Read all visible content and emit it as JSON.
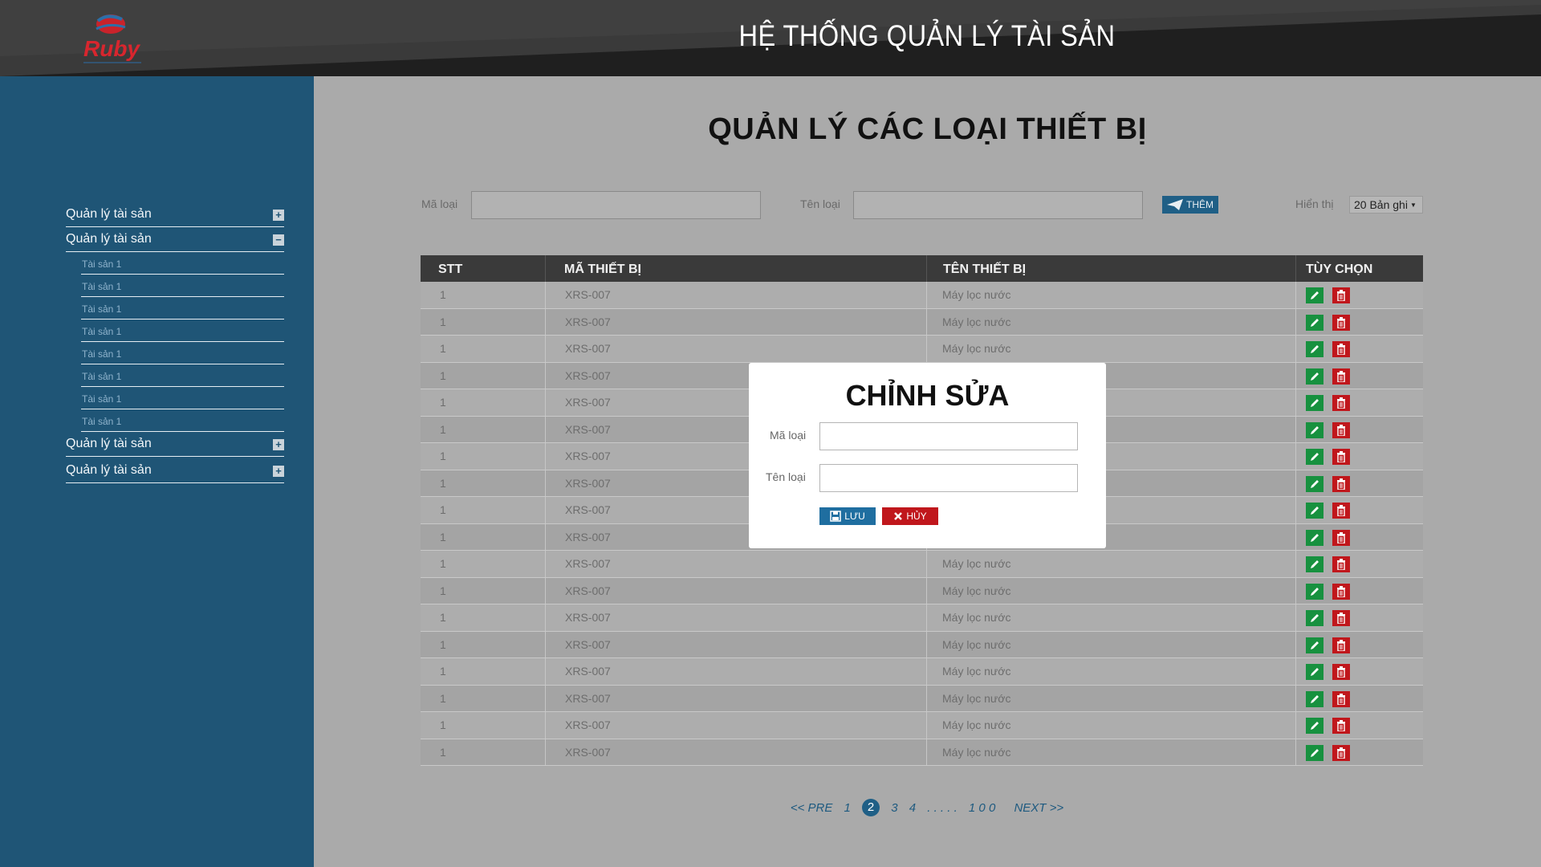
{
  "header": {
    "title": "HỆ THỐNG QUẢN LÝ TÀI SẢN",
    "logo_text": "Ruby"
  },
  "sidebar": {
    "groups": [
      {
        "label": "Quản lý tài sản",
        "toggle": "+"
      },
      {
        "label": "Quản lý tài sản",
        "toggle": "−",
        "items": [
          "Tài sản 1",
          "Tài sản 1",
          "Tài sản 1",
          "Tài sản 1",
          "Tài sản 1",
          "Tài sản 1",
          "Tài sản 1",
          "Tài sản 1"
        ]
      },
      {
        "label": "Quản lý tài sản",
        "toggle": "+"
      },
      {
        "label": "Quản lý tài sản",
        "toggle": "+"
      }
    ]
  },
  "main": {
    "title": "QUẢN LÝ CÁC LOẠI THIẾT BỊ",
    "filter": {
      "code_label": "Mã loại",
      "code_value": "",
      "name_label": "Tên loại",
      "name_value": "",
      "add_label": "THÊM",
      "display_label": "Hiển thị",
      "display_value": "20 Bản ghi"
    },
    "table": {
      "columns": [
        "STT",
        "MÃ THIẾT BỊ",
        "TÊN THIẾT BỊ",
        "TÙY CHỌN"
      ],
      "rows": [
        [
          "1",
          "XRS-007",
          "Máy lọc nước"
        ],
        [
          "1",
          "XRS-007",
          "Máy lọc nước"
        ],
        [
          "1",
          "XRS-007",
          "Máy lọc nước"
        ],
        [
          "1",
          "XRS-007",
          ""
        ],
        [
          "1",
          "XRS-007",
          ""
        ],
        [
          "1",
          "XRS-007",
          ""
        ],
        [
          "1",
          "XRS-007",
          ""
        ],
        [
          "1",
          "XRS-007",
          ""
        ],
        [
          "1",
          "XRS-007",
          ""
        ],
        [
          "1",
          "XRS-007",
          ""
        ],
        [
          "1",
          "XRS-007",
          "Máy lọc nước"
        ],
        [
          "1",
          "XRS-007",
          "Máy lọc nước"
        ],
        [
          "1",
          "XRS-007",
          "Máy lọc nước"
        ],
        [
          "1",
          "XRS-007",
          "Máy lọc nước"
        ],
        [
          "1",
          "XRS-007",
          "Máy lọc nước"
        ],
        [
          "1",
          "XRS-007",
          "Máy lọc nước"
        ],
        [
          "1",
          "XRS-007",
          "Máy lọc nước"
        ],
        [
          "1",
          "XRS-007",
          "Máy lọc nước"
        ]
      ]
    },
    "pagination": {
      "prev": "<< PRE",
      "pages": [
        "1",
        "2",
        "3",
        "4"
      ],
      "current": "2",
      "ellipsis": ". . . . .",
      "last": "1 0 0",
      "next": "NEXT >>"
    }
  },
  "modal": {
    "title": "CHỈNH SỬA",
    "code_label": "Mã loại",
    "code_value": "",
    "name_label": "Tên loại",
    "name_value": "",
    "save_label": "LƯU",
    "cancel_label": "HỦY"
  },
  "colors": {
    "sidebar": "#1f5576",
    "header": "#1f1f1f",
    "primary_button": "#1f5f86",
    "edit_button": "#17913f",
    "delete_button": "#c0171c"
  },
  "icons": {
    "add": "paper-plane-icon",
    "edit": "pencil-icon",
    "delete": "trash-icon",
    "save": "floppy-icon",
    "cancel": "x-icon"
  }
}
